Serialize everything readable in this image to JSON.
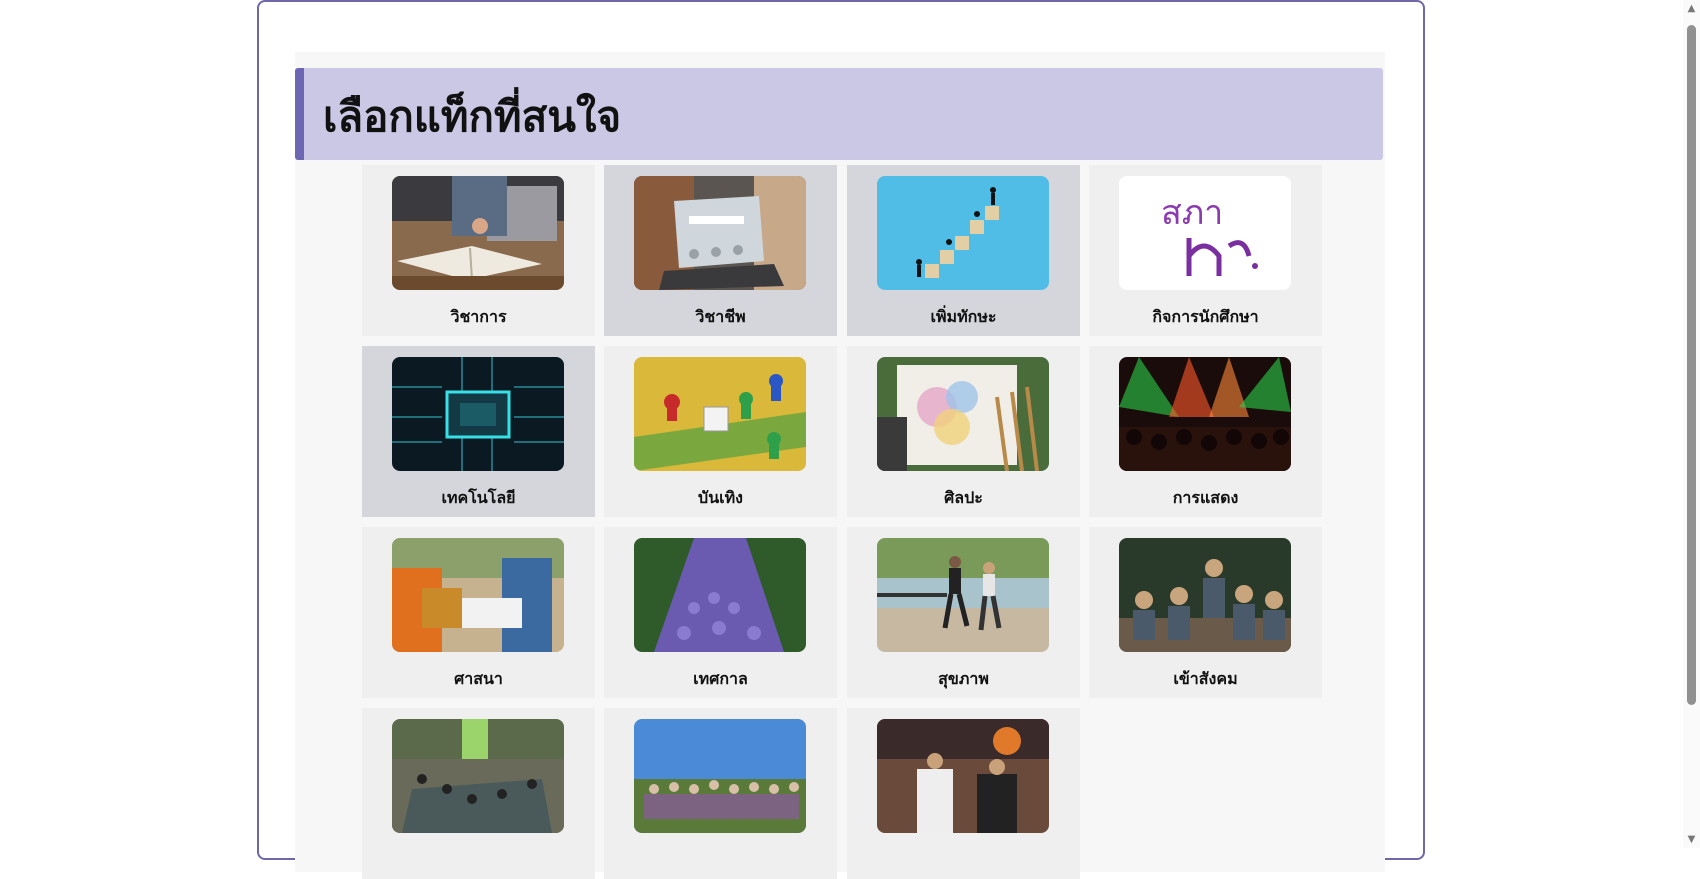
{
  "page": {
    "heading": "เลือกแท็กที่สนใจ"
  },
  "tags": [
    {
      "label": "วิชาการ",
      "icon": "study-book-image",
      "selected": false
    },
    {
      "label": "วิชาชีพ",
      "icon": "job-search-laptop-image",
      "selected": true
    },
    {
      "label": "เพิ่มทักษะ",
      "icon": "skill-blocks-image",
      "selected": true
    },
    {
      "label": "กิจการนักศึกษา",
      "icon": "student-council-logo-image",
      "logo_text": "สภา",
      "selected": false
    },
    {
      "label": "เทคโนโลยี",
      "icon": "circuit-chip-image",
      "selected": true
    },
    {
      "label": "บันเทิง",
      "icon": "board-game-image",
      "selected": false
    },
    {
      "label": "ศิลปะ",
      "icon": "painting-image",
      "selected": false
    },
    {
      "label": "การแสดง",
      "icon": "concert-image",
      "selected": false
    },
    {
      "label": "ศาสนา",
      "icon": "alms-giving-image",
      "selected": false
    },
    {
      "label": "เทศกาล",
      "icon": "festival-crowd-image",
      "selected": false
    },
    {
      "label": "สุขภาพ",
      "icon": "running-image",
      "selected": false
    },
    {
      "label": "เข้าสังคม",
      "icon": "social-dinner-image",
      "selected": false
    },
    {
      "label": "",
      "icon": "volunteer-pond-image",
      "selected": false
    },
    {
      "label": "",
      "icon": "group-photo-image",
      "selected": false
    },
    {
      "label": "",
      "icon": "basketball-image",
      "selected": false
    }
  ],
  "colors": {
    "header_bg": "#cac8e4",
    "header_accent": "#6d67b3",
    "card_bg": "#efefef",
    "card_selected_bg": "#d4d6dc"
  },
  "scrollbar": {
    "up_icon": "scroll-up-arrow-icon",
    "down_icon": "scroll-down-arrow-icon"
  }
}
